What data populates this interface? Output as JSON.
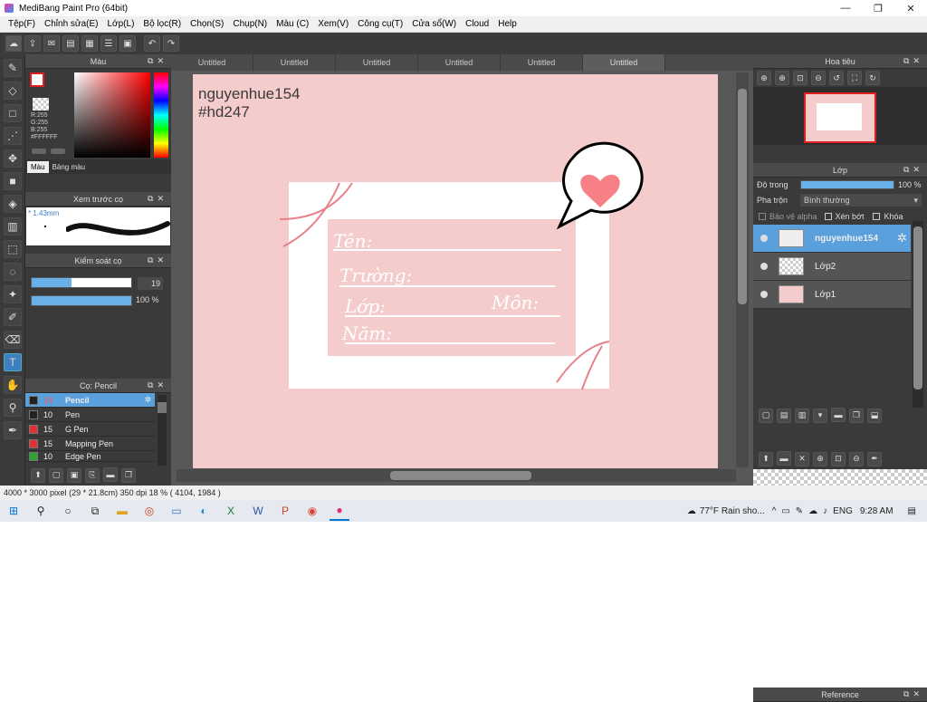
{
  "window": {
    "title": "MediBang Paint Pro (64bit)",
    "min": "—",
    "max": "❐",
    "close": "✕"
  },
  "menu": [
    "Tệp(F)",
    "Chỉnh sửa(E)",
    "Lớp(L)",
    "Bộ lọc(R)",
    "Chọn(S)",
    "Chụp(N)",
    "Màu (C)",
    "Xem(V)",
    "Công cụ(T)",
    "Cửa sổ(W)",
    "Cloud",
    "Help"
  ],
  "toolbar": {
    "undo": "↶",
    "redo": "↷"
  },
  "tabs": [
    "Untitled",
    "Untitled",
    "Untitled",
    "Untitled",
    "Untitled",
    "Untitled"
  ],
  "color_panel": {
    "title": "Màu",
    "r": "R:255",
    "g": "G:255",
    "b": "B:255",
    "hex": "#FFFFFF",
    "tab1": "Màu",
    "tab2": "Bảng màu"
  },
  "brush_preview": {
    "title": "Xem trước cọ",
    "size": "* 1.43mm"
  },
  "brush_control": {
    "title": "Kiểm soát cọ",
    "size_value": "19",
    "opacity_value": "100 %"
  },
  "brush_list": {
    "title": "Cọ: Pencil",
    "items": [
      {
        "size": "19",
        "name": "Pencil",
        "color": "#222222"
      },
      {
        "size": "10",
        "name": "Pen",
        "color": "#222222"
      },
      {
        "size": "15",
        "name": "G Pen",
        "color": "#e03030"
      },
      {
        "size": "15",
        "name": "Mapping Pen",
        "color": "#e03030"
      },
      {
        "size": "10",
        "name": "Edge Pen",
        "color": "#30a030"
      }
    ]
  },
  "canvas": {
    "line1": "nguyenhue154",
    "line2": "#hd247",
    "field1": "Tên:",
    "field2": "Trường:",
    "field3": "Lớp:",
    "field4": "Môn:",
    "field5": "Năm:"
  },
  "navigator": {
    "title": "Hoa tiêu"
  },
  "layers": {
    "title": "Lớp",
    "opacity_label": "Độ trong",
    "opacity_value": "100 %",
    "blend_label": "Pha trộn",
    "blend_value": "Bình thường",
    "protect_alpha": "Bảo vệ alpha",
    "clip": "Xén bớt",
    "lock": "Khóa",
    "items": [
      {
        "name": "nguyenhue154"
      },
      {
        "name": "Lớp2"
      },
      {
        "name": "Lớp1"
      }
    ]
  },
  "reference": {
    "title": "Reference"
  },
  "status": {
    "size": "4000 * 3000 pixel",
    "dim": "(29 * 21.8cm)",
    "dpi": "350 dpi",
    "zoom": "18 %",
    "coord": "( 4104, 1984 )"
  },
  "taskbar": {
    "weather": "77°F  Rain sho...",
    "lang": "ENG",
    "time": "9:28 AM"
  },
  "colors": {
    "accent": "#5aa0dc",
    "canvas_bg": "#f5cccc",
    "heart": "#f77f86"
  }
}
